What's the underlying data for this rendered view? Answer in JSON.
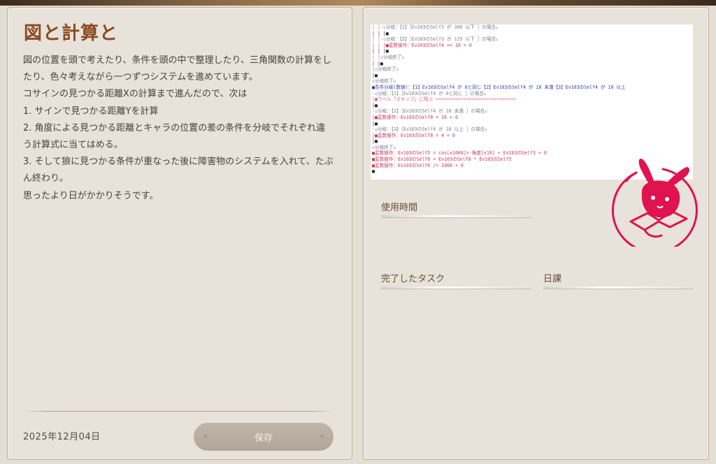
{
  "diary": {
    "title": "図と計算と",
    "body_lines": [
      "図の位置を頭で考えたり、条件を頭の中で整理したり、三角関数の計算をし",
      "たり、色々考えながら一つずつシステムを進めています。",
      "コサインの見つかる距離Xの計算まで進んだので、次は",
      "1. サインで見つかる距離Yを計算",
      "2. 角度による見つかる距離とキャラの位置の差の条件を分岐でそれぞれ違",
      "う計算式に当てはめる。",
      "3. そして狼に見つかる条件が重なった後に障害物のシステムを入れて、たぶ",
      "ん終わり。",
      "思ったより日がかかりそうです。"
    ],
    "date": "2025年12月04日",
    "save_label": "保存"
  },
  "screenshot": {
    "lines": [
      {
        "text": "| |-◇分岐：【1】［Ev103のSelf3 が 300 以下 ］の場合↓",
        "color": "gray"
      },
      {
        "text": "| | |■",
        "color": "black"
      },
      {
        "text": "| |-◇分岐：【2】［Ev103のSelf3 が 125 以下 ］の場合↓",
        "color": "gray"
      },
      {
        "text": "| | |■変数操作：Ev103のSelf4 += 10 + 0",
        "color": "red"
      },
      {
        "text": "| | |■",
        "color": "black"
      },
      {
        "text": "| |◇分岐終了◇",
        "color": "gray"
      },
      {
        "text": "| |■",
        "color": "black"
      },
      {
        "text": "|◇分岐終了◇",
        "color": "gray"
      },
      {
        "text": "|■",
        "color": "black"
      },
      {
        "text": "◇分岐終了◇",
        "color": "gray"
      },
      {
        "text": "■条件分岐(数値)：【1】Ev103のSelf4 が 0と同じ【2】Ev103のSelf4 が 10 未満【3】Ev103のSelf4 が 10 以上",
        "color": "blue"
      },
      {
        "text": "-◇分岐：【1】［Ev103のSelf4 が 0と同じ ］の場合↓",
        "color": "gray"
      },
      {
        "text": "|■ラベル「スキップ」に飛ぶ >>>>>>>>>>>>>>>>>>>>>>>>>>>>>",
        "color": "pink"
      },
      {
        "text": "|■",
        "color": "black"
      },
      {
        "text": "-◇分岐：【2】［Ev103のSelf4 が 10 未満 ］の場合↓",
        "color": "gray"
      },
      {
        "text": "|■変数操作：Ev103のSelf8 = 16 + 0",
        "color": "red"
      },
      {
        "text": "|■",
        "color": "black"
      },
      {
        "text": "-◇分岐：【3】［Ev103のSelf4 が 10 以上 ］の場合↓",
        "color": "gray"
      },
      {
        "text": "|■変数操作：Ev103のSelf8 = 4 + 0",
        "color": "red"
      },
      {
        "text": "|■",
        "color": "black"
      },
      {
        "text": "◇分岐終了◇",
        "color": "gray"
      },
      {
        "text": "■変数操作：Ev103のSelf5 = cos[x1000]=-角度[x10] + Ev103のSelf3 + 0",
        "color": "red"
      },
      {
        "text": "■変数操作：Ev103のSelf6 = Ev103のSelf8 * Ev103のSelf5",
        "color": "red"
      },
      {
        "text": "■変数操作：Ev103のSelf6 /= 1000 + 0",
        "color": "red"
      },
      {
        "text": "■",
        "color": "black"
      }
    ]
  },
  "stats": {
    "usage_time_label": "使用時間",
    "completed_tasks_label": "完了したタスク",
    "daily_label": "日課"
  },
  "colors": {
    "accent": "#8c4a22",
    "stamp": "#e0124f",
    "panel_bg": "#e7e3da"
  }
}
